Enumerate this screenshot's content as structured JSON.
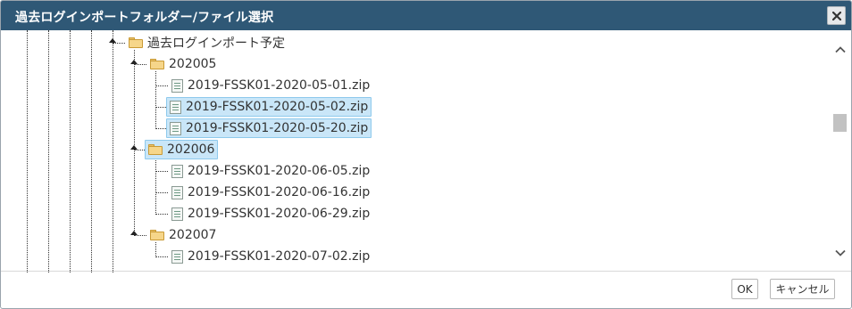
{
  "dialog": {
    "title": "過去ログインポートフォルダー/ファイル選択",
    "close_icon": "close-icon"
  },
  "tree": {
    "root_folder": {
      "label": "過去ログインポート予定",
      "icon": "folder-icon",
      "expanded": true
    },
    "folders": [
      {
        "label": "202005",
        "icon": "folder-icon",
        "expanded": true,
        "selected": false,
        "files": [
          {
            "label": "2019-FSSK01-2020-05-01.zip",
            "icon": "file-icon",
            "selected": false
          },
          {
            "label": "2019-FSSK01-2020-05-02.zip",
            "icon": "file-icon",
            "selected": true
          },
          {
            "label": "2019-FSSK01-2020-05-20.zip",
            "icon": "file-icon",
            "selected": true
          }
        ]
      },
      {
        "label": "202006",
        "icon": "folder-icon",
        "expanded": true,
        "selected": true,
        "files": [
          {
            "label": "2019-FSSK01-2020-06-05.zip",
            "icon": "file-icon",
            "selected": false
          },
          {
            "label": "2019-FSSK01-2020-06-16.zip",
            "icon": "file-icon",
            "selected": false
          },
          {
            "label": "2019-FSSK01-2020-06-29.zip",
            "icon": "file-icon",
            "selected": false
          }
        ]
      },
      {
        "label": "202007",
        "icon": "folder-icon",
        "expanded": true,
        "selected": false,
        "files": [
          {
            "label": "2019-FSSK01-2020-07-02.zip",
            "icon": "file-icon",
            "selected": false
          }
        ]
      }
    ]
  },
  "scrollbar": {
    "up_icon": "chevron-up-icon",
    "down_icon": "chevron-down-icon"
  },
  "footer": {
    "ok_label": "OK",
    "cancel_label": "キャンセル"
  },
  "colors": {
    "titlebar": "#2f5876",
    "title_text": "#ffffff",
    "selection_bg": "#c9e6f8",
    "selection_border": "#8ec9ec"
  }
}
